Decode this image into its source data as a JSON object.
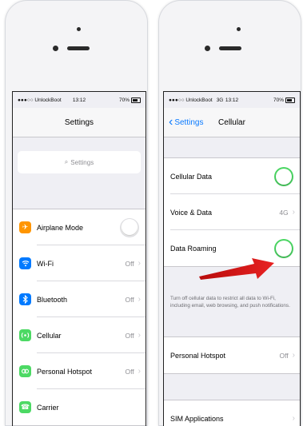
{
  "left": {
    "status": {
      "carrier": "●●●○○ UnlockBoot",
      "time": "13:12",
      "battery": "70%"
    },
    "nav_title": "Settings",
    "search_placeholder": "Settings",
    "rows": [
      {
        "label": "Airplane Mode",
        "icon": "airplane-icon",
        "color": "#ff9500",
        "glyph": "✈",
        "toggle": "off"
      },
      {
        "label": "Wi-Fi",
        "icon": "wifi-icon",
        "color": "#007aff",
        "glyph": "◔",
        "value": "Off"
      },
      {
        "label": "Bluetooth",
        "icon": "bluetooth-icon",
        "color": "#007aff",
        "glyph": "ᛒ",
        "value": "Off"
      },
      {
        "label": "Cellular",
        "icon": "cellular-icon",
        "color": "#4cd964",
        "glyph": "◎",
        "value": "Off"
      },
      {
        "label": "Personal Hotspot",
        "icon": "hotspot-icon",
        "color": "#4cd964",
        "glyph": "∞",
        "value": "Off"
      },
      {
        "label": "Carrier",
        "icon": "phone-icon",
        "color": "#4cd964",
        "glyph": "☎"
      }
    ]
  },
  "right": {
    "status": {
      "carrier": "●●●○○ UnlockBoot",
      "network": "3G",
      "time": "13:12",
      "battery": "70%"
    },
    "back_label": "Settings",
    "nav_title": "Cellular",
    "rows": {
      "cellular_data": {
        "label": "Cellular Data",
        "toggle": "on"
      },
      "voice_data": {
        "label": "Voice & Data",
        "value": "4G"
      },
      "data_roaming": {
        "label": "Data Roaming",
        "toggle": "on"
      }
    },
    "footnote": "Turn off cellular data to restrict all data to Wi-Fi, including email, web browsing, and push notifications.",
    "personal_hotspot": {
      "label": "Personal Hotspot",
      "value": "Off"
    },
    "sim_applications": {
      "label": "SIM Applications"
    }
  },
  "colors": {
    "accent": "#0a7aff",
    "toggle_on": "#4cd964",
    "arrow": "#e02020"
  }
}
